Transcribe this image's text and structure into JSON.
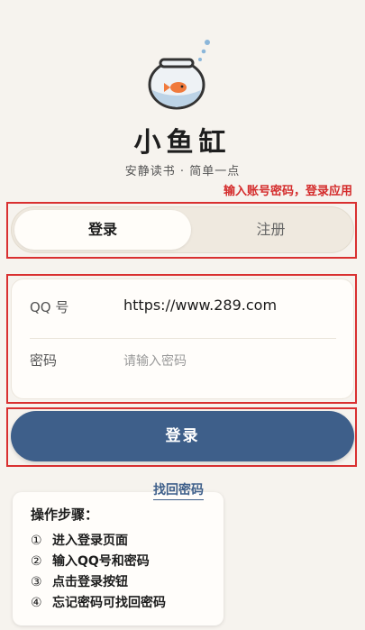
{
  "app": {
    "title": "小鱼缸",
    "subtitle": "安静读书 · 简单一点"
  },
  "annotation": "输入账号密码，登录应用",
  "tabs": [
    {
      "label": "登录",
      "active": true
    },
    {
      "label": "注册",
      "active": false
    }
  ],
  "form": {
    "account": {
      "label": "QQ 号",
      "value": "https://www.289.com"
    },
    "password": {
      "label": "密码",
      "placeholder": "请输入密码"
    }
  },
  "login_button": "登录",
  "forgot_link": "找回密码",
  "steps": {
    "title": "操作步骤：",
    "items": [
      {
        "num": "①",
        "text": "进入登录页面"
      },
      {
        "num": "②",
        "text": "输入QQ号和密码"
      },
      {
        "num": "③",
        "text": "点击登录按钮"
      },
      {
        "num": "④",
        "text": "忘记密码可找回密码"
      }
    ]
  },
  "colors": {
    "accent": "#3e5f8a",
    "annotation": "#d93030",
    "background": "#f6f3ee"
  },
  "icons": {
    "logo": "fishbowl-icon"
  }
}
